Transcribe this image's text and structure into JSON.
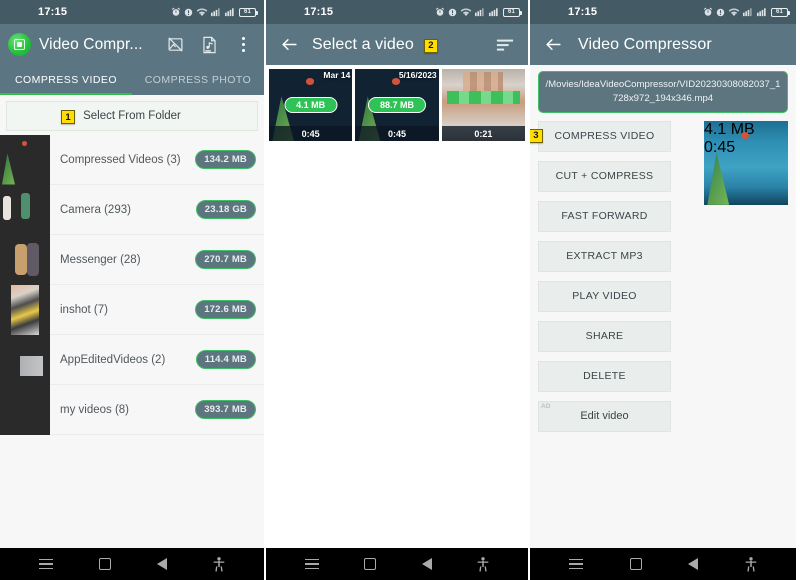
{
  "status_bar": {
    "time": "17:15",
    "icons": [
      "alarm-icon",
      "dnd-icon",
      "wifi-icon",
      "signal-icon",
      "signal-icon"
    ],
    "battery_level": "61"
  },
  "nav_bar": {
    "items": [
      "menu-button",
      "home-button",
      "back-button",
      "accessibility-button"
    ]
  },
  "panel1": {
    "app_title": "Video Compr...",
    "logo": "video-compressor-logo",
    "actions": [
      {
        "name": "no-image-icon"
      },
      {
        "name": "audio-file-icon"
      },
      {
        "name": "overflow-menu-icon"
      }
    ],
    "tabs": [
      {
        "label": "COMPRESS VIDEO",
        "active": true
      },
      {
        "label": "COMPRESS PHOTO",
        "active": false
      }
    ],
    "select_from_folder": {
      "label": "Select From Folder",
      "badge": "1"
    },
    "folders": [
      {
        "name": "Compressed Videos (3)",
        "size": "134.2 MB",
        "thumb": "t-sea"
      },
      {
        "name": "Camera (293)",
        "size": "23.18 GB",
        "thumb": "t-beach"
      },
      {
        "name": "Messenger (28)",
        "size": "270.7 MB",
        "thumb": "t-people"
      },
      {
        "name": "inshot (7)",
        "size": "172.6 MB",
        "thumb": "t-inshot"
      },
      {
        "name": "AppEditedVideos (2)",
        "size": "114.4 MB",
        "thumb": "t-rgb"
      },
      {
        "name": "my videos (8)",
        "size": "393.7 MB",
        "thumb": "t-black"
      }
    ]
  },
  "panel2": {
    "title": "Select a video",
    "title_badge": "2",
    "back_icon": "back-arrow-icon",
    "sort_icon": "sort-icon",
    "videos": [
      {
        "date": "Mar 14",
        "size": "4.1 MB",
        "duration": "0:45",
        "thumb": "t-sea"
      },
      {
        "date": "5/16/2023",
        "size": "88.7 MB",
        "duration": "0:45",
        "thumb": "t-sea"
      },
      {
        "date": "",
        "size": "",
        "duration": "0:21",
        "thumb": "t-face"
      }
    ]
  },
  "panel3": {
    "title": "Video Compressor",
    "back_icon": "back-arrow-icon",
    "file_path": "/Movies/IdeaVideoCompressor/VID20230308082037_1728x972_194x346.mp4",
    "first_badge": "3",
    "buttons": [
      {
        "label": "COMPRESS VIDEO",
        "ad": false
      },
      {
        "label": "CUT + COMPRESS",
        "ad": false
      },
      {
        "label": "FAST FORWARD",
        "ad": false
      },
      {
        "label": "EXTRACT MP3",
        "ad": false
      },
      {
        "label": "PLAY VIDEO",
        "ad": false
      },
      {
        "label": "SHARE",
        "ad": false
      },
      {
        "label": "DELETE",
        "ad": false
      },
      {
        "label": "Edit video",
        "ad": true,
        "ad_label": "AD"
      }
    ],
    "preview": {
      "size": "4.1 MB",
      "duration": "0:45",
      "thumb": "t-sea"
    }
  },
  "colors": {
    "appbar": "#5b7682",
    "statusbar": "#445b66",
    "accent_green": "#2fbf4a",
    "badge_yellow": "#ffdd00",
    "size_pill_bg": "#5d757f",
    "button_bg": "#e9eeed"
  }
}
